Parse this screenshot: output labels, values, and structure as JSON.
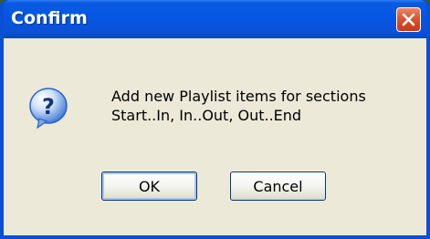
{
  "dialog": {
    "title": "Confirm",
    "message_line1": "Add new Playlist items for sections",
    "message_line2": "Start..In, In..Out, Out..End",
    "icon": "question-icon",
    "buttons": {
      "ok_label": "OK",
      "cancel_label": "Cancel"
    },
    "close_icon": "close-icon"
  },
  "colors": {
    "titlebar": "#0556e3",
    "body": "#ece9d8",
    "close_button": "#d8562e",
    "icon_blue": "#2a63c9"
  }
}
